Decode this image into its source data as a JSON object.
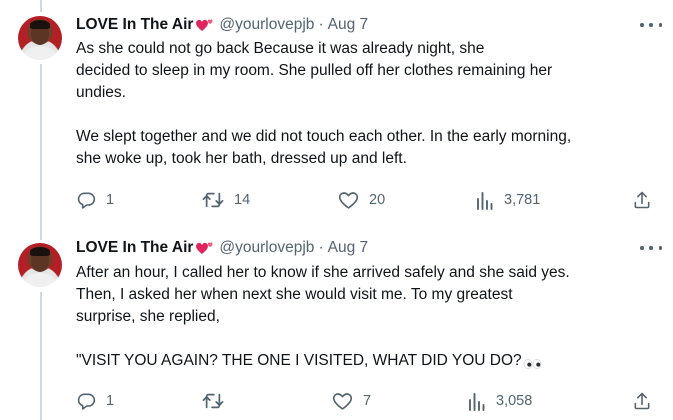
{
  "tweets": [
    {
      "author_name": "LOVE In The Air",
      "handle": "@yourlovepjb",
      "separator": "·",
      "date": "Aug 7",
      "lines": [
        "As she could not go back Because it was already night, she",
        "decided to sleep in my room. She pulled off her clothes remaining her",
        "undies.",
        "",
        "We slept together and we did not touch each other. In the early morning,",
        "she woke up, took her bath, dressed up and left."
      ],
      "stats": {
        "replies": "1",
        "reposts": "14",
        "likes": "20",
        "views": "3,781"
      }
    },
    {
      "author_name": "LOVE In The Air",
      "handle": "@yourlovepjb",
      "separator": "·",
      "date": "Aug 7",
      "lines": [
        "After an hour, I called her to know if she arrived safely and she said yes.",
        "Then, I asked her when next she would visit me. To my greatest",
        "surprise, she replied,",
        "",
        "\"VISIT YOU AGAIN? THE ONE I VISITED, WHAT DID YOU DO?"
      ],
      "stats": {
        "replies": "1",
        "reposts": "",
        "likes": "7",
        "views": "3,058"
      }
    }
  ],
  "icons": {
    "heart": "two-hearts-icon",
    "eyes": "eyes-emoji-icon",
    "reply": "reply-icon",
    "repost": "repost-icon",
    "like": "like-icon",
    "views": "views-icon",
    "share": "share-icon",
    "more": "more-icon"
  },
  "colors": {
    "text": "#0f1419",
    "muted": "#536471",
    "heart": "#e0245e",
    "thread_line": "#cfd9de"
  }
}
